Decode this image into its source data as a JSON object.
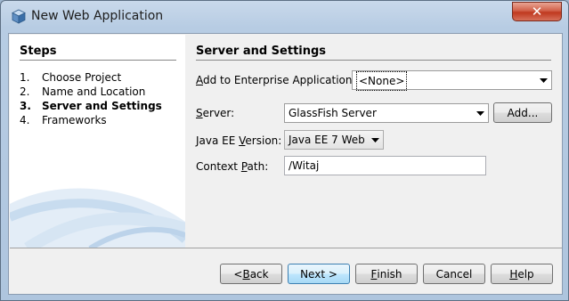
{
  "window": {
    "title": "New Web Application",
    "close_symbol": "✕"
  },
  "steps": {
    "title": "Steps",
    "items": [
      {
        "num": "1.",
        "label": "Choose Project",
        "active": false
      },
      {
        "num": "2.",
        "label": "Name and Location",
        "active": false
      },
      {
        "num": "3.",
        "label": "Server and Settings",
        "active": true
      },
      {
        "num": "4.",
        "label": "Frameworks",
        "active": false
      }
    ]
  },
  "panel": {
    "title": "Server and Settings",
    "enterprise_app": {
      "label_u": "A",
      "label_rest": "dd to Enterprise Application:",
      "value": "<None>"
    },
    "server": {
      "label_u": "S",
      "label_rest": "erver:",
      "value": "GlassFish Server",
      "add_button": "Add..."
    },
    "java_ee": {
      "label_pre": "Java EE ",
      "label_u": "V",
      "label_rest": "ersion:",
      "value": "Java EE 7 Web"
    },
    "context_path": {
      "label_pre": "Context ",
      "label_u": "P",
      "label_rest": "ath:",
      "value": "/Witaj"
    }
  },
  "buttons": {
    "back": {
      "pre": "< ",
      "u": "B",
      "rest": "ack"
    },
    "next": {
      "pre": "Next >",
      "u": "",
      "rest": ""
    },
    "finish": {
      "pre": "",
      "u": "F",
      "rest": "inish"
    },
    "cancel": {
      "pre": "Cancel",
      "u": "",
      "rest": ""
    },
    "help": {
      "pre": "",
      "u": "H",
      "rest": "elp"
    }
  }
}
